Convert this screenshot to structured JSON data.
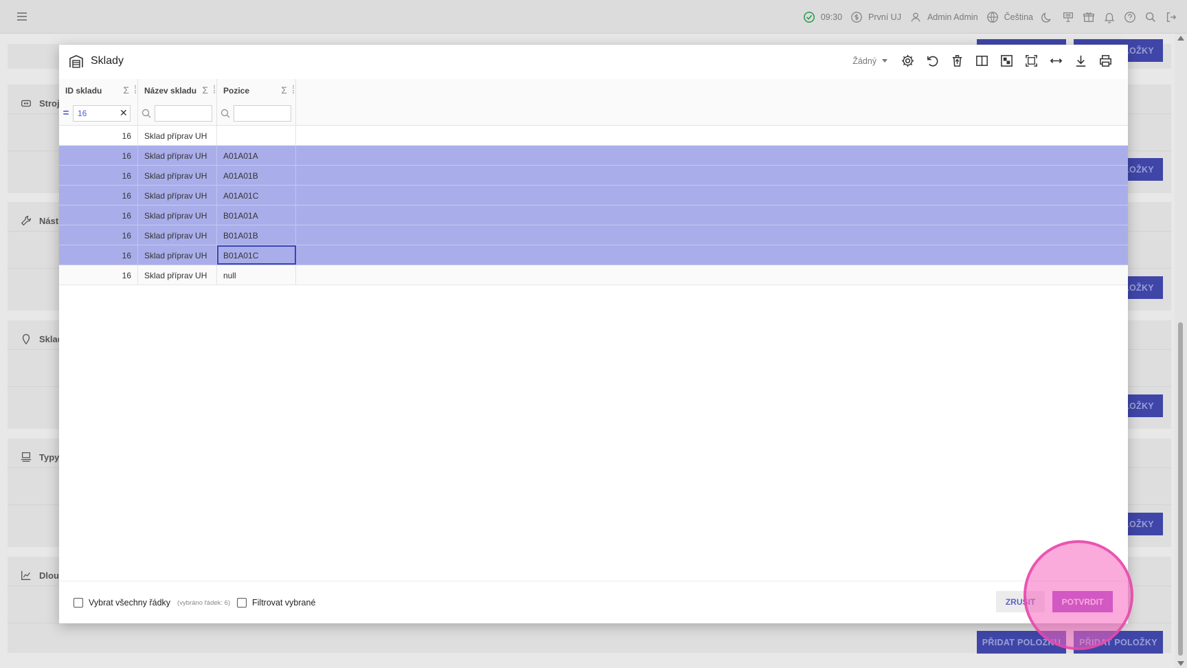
{
  "topbar": {
    "time": "09:30",
    "unit": "První UJ",
    "user": "Admin Admin",
    "language": "Čeština"
  },
  "background": {
    "sections": [
      {
        "label": "Stroj"
      },
      {
        "label": "Nástro"
      },
      {
        "label": "Sklado"
      },
      {
        "label": "Typy"
      },
      {
        "label": "Dlouh"
      }
    ],
    "buttons": {
      "add_item": "PŘIDAT POLOŽKU",
      "add_items": "PŘIDAT POLOŽKY",
      "items_short": "LOŽKY"
    }
  },
  "dialog": {
    "title": "Sklady",
    "view_select": "Žádný",
    "columns": [
      {
        "label": "ID skladu",
        "sigma": "Σ"
      },
      {
        "label": "Název skladu",
        "sigma": "Σ"
      },
      {
        "label": "Pozice",
        "sigma": "Σ"
      }
    ],
    "filter": {
      "id_value": "16",
      "eq_symbol": "=",
      "clear_symbol": "✕"
    },
    "rows": [
      {
        "id": "16",
        "name": "Sklad příprav UH",
        "pos": ""
      },
      {
        "id": "16",
        "name": "Sklad příprav UH",
        "pos": "A01A01A"
      },
      {
        "id": "16",
        "name": "Sklad příprav UH",
        "pos": "A01A01B"
      },
      {
        "id": "16",
        "name": "Sklad příprav UH",
        "pos": "A01A01C"
      },
      {
        "id": "16",
        "name": "Sklad příprav UH",
        "pos": "B01A01A"
      },
      {
        "id": "16",
        "name": "Sklad příprav UH",
        "pos": "B01A01B"
      },
      {
        "id": "16",
        "name": "Sklad příprav UH",
        "pos": "B01A01C"
      },
      {
        "id": "16",
        "name": "Sklad příprav UH",
        "pos": "null"
      }
    ],
    "footer": {
      "select_all": "Vybrat všechny řádky",
      "selected_count": "(vybráno řádek: 6)",
      "filter_selected": "Filtrovat vybrané",
      "cancel": "ZRUŠIT",
      "confirm": "POTVRDIT"
    }
  },
  "colors": {
    "accent": "#3f46a8",
    "selected_row": "#a9aeea",
    "confirm": "#a749c9",
    "highlight": "#f664be"
  }
}
